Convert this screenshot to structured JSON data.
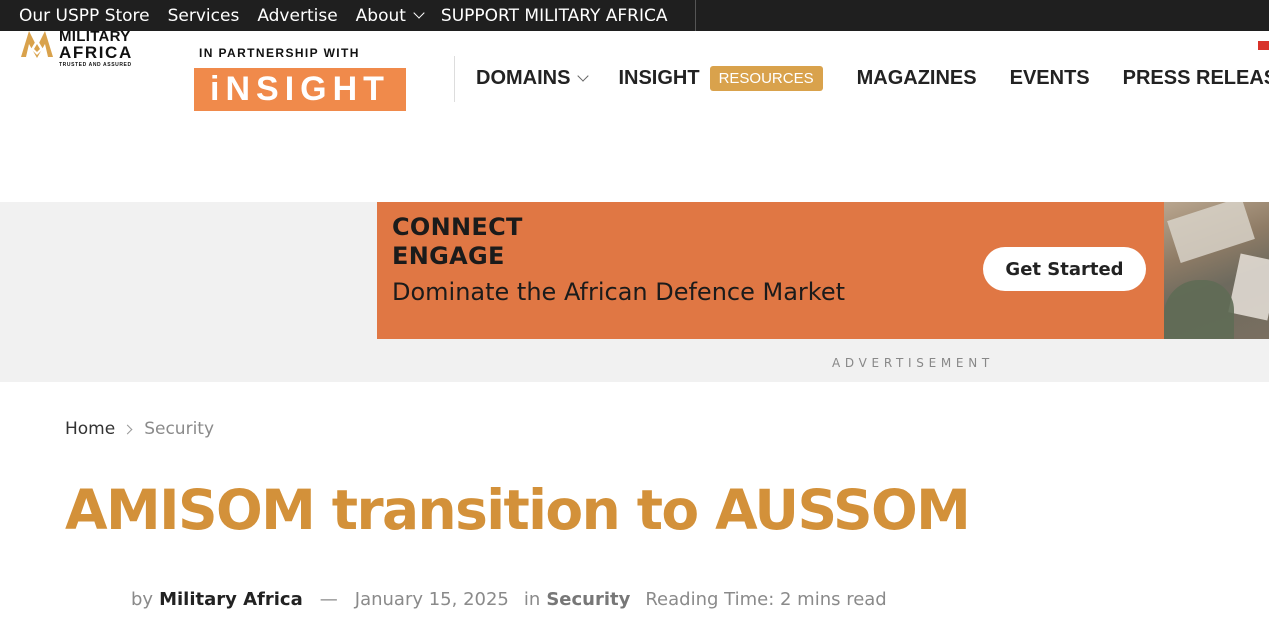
{
  "topbar": {
    "links": [
      "Our USPP Store",
      "Services",
      "Advertise"
    ],
    "about_label": "About",
    "support_label": "SUPPORT MILITARY AFRICA"
  },
  "logo": {
    "line1": "MILITARY",
    "line2": "AFRICA",
    "tagline": "TRUSTED AND ASSURED",
    "icon": "military-africa-mark"
  },
  "partnership": {
    "label": "IN PARTNERSHIP WITH",
    "brand": "iNSIGHT"
  },
  "nav": {
    "domains": "DOMAINS",
    "insight": "INSIGHT",
    "resources_badge": "RESOURCES",
    "magazines": "MAGAZINES",
    "events": "EVENTS",
    "press_release": "PRESS RELEASE"
  },
  "ad": {
    "line1": "CONNECT",
    "line2": "ENGAGE",
    "line3": "Dominate the African Defence Market",
    "cta": "Get Started",
    "label": "ADVERTISEMENT"
  },
  "breadcrumb": {
    "home": "Home",
    "current": "Security"
  },
  "article": {
    "title": "AMISOM transition to AUSSOM",
    "by": "by",
    "author": "Military Africa",
    "dash": "—",
    "date": "January 15, 2025",
    "in": "in",
    "category": "Security",
    "reading_time": "Reading Time: 2 mins read"
  },
  "colors": {
    "accent": "#d3913a",
    "badge": "#d9a24c",
    "ad_bg": "#e07744",
    "insight_bg": "#f08a4b",
    "topbar_bg": "#1f1f1f"
  }
}
